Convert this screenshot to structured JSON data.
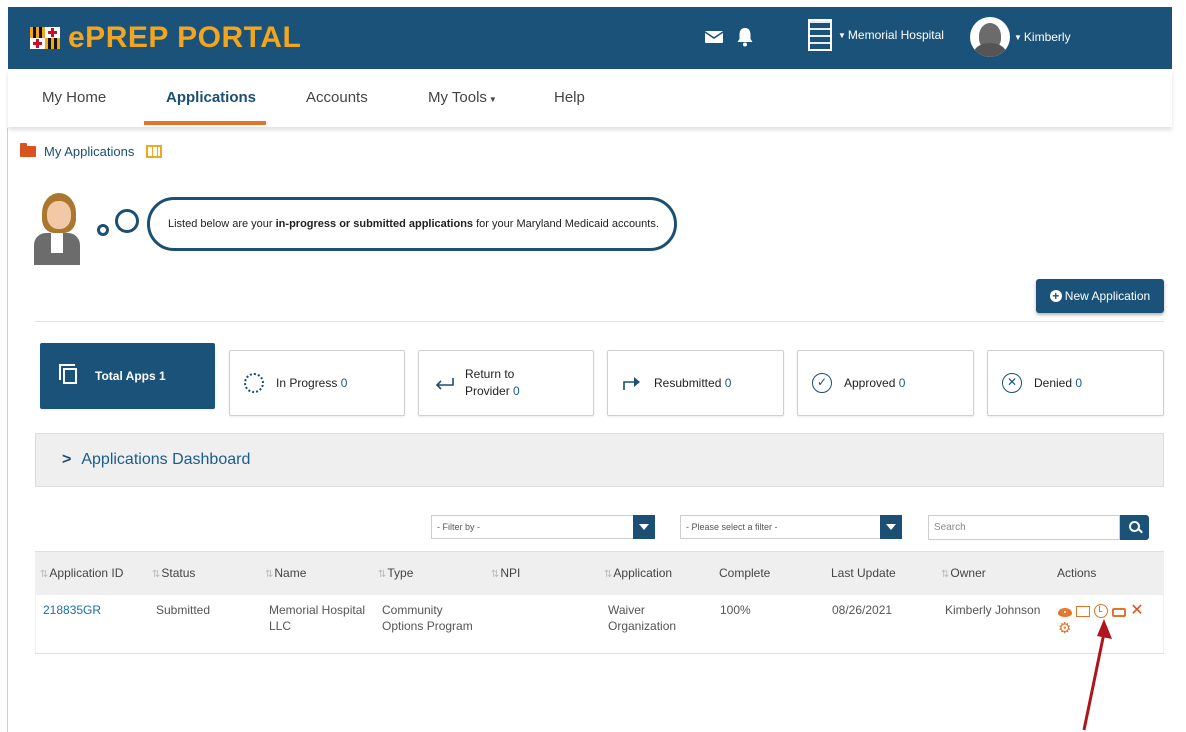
{
  "header": {
    "logo_text": "ePREP PORTAL",
    "organization": "Memorial Hospital",
    "user_name": "Kimberly"
  },
  "nav": {
    "items": [
      {
        "label": "My Home"
      },
      {
        "label": "Applications",
        "active": true
      },
      {
        "label": "Accounts"
      },
      {
        "label": "My Tools"
      },
      {
        "label": "Help"
      }
    ]
  },
  "breadcrumb": {
    "label": "My Applications"
  },
  "assistant": {
    "text_before": "Listed below are your ",
    "text_bold": "in-progress or submitted applications",
    "text_after": " for your Maryland Medicaid accounts."
  },
  "new_application_label": "New Application",
  "stats": {
    "total_label": "Total Apps",
    "total_value": "1",
    "in_progress_label": "In Progress",
    "in_progress_value": "0",
    "return_label_1": "Return to",
    "return_label_2": "Provider",
    "return_value": "0",
    "resubmitted_label": "Resubmitted",
    "resubmitted_value": "0",
    "approved_label": "Approved",
    "approved_value": "0",
    "denied_label": "Denied",
    "denied_value": "0"
  },
  "dashboard_label": "Applications Dashboard",
  "filters": {
    "filter_by": "- Filter by -",
    "select_filter": "- Please select a filter -",
    "search_placeholder": "Search"
  },
  "table": {
    "headers": {
      "app_id": "Application ID",
      "status": "Status",
      "name": "Name",
      "type": "Type",
      "npi": "NPI",
      "application": "Application",
      "complete": "Complete",
      "last_update": "Last Update",
      "owner": "Owner",
      "actions": "Actions"
    },
    "rows": [
      {
        "app_id": "218835GR",
        "status": "Submitted",
        "name_1": "Memorial Hospital",
        "name_2": "LLC",
        "type_1": "Community",
        "type_2": "Options Program",
        "npi": "",
        "application_1": "Waiver",
        "application_2": "Organization",
        "complete": "100%",
        "last_update": "08/26/2021",
        "owner": "Kimberly Johnson"
      }
    ]
  },
  "colors": {
    "header_bg": "#1b5279",
    "logo": "#f3a51d",
    "accent_orange": "#e2752b",
    "link_blue": "#1b6fae",
    "annotation_arrow": "#b0141c"
  }
}
